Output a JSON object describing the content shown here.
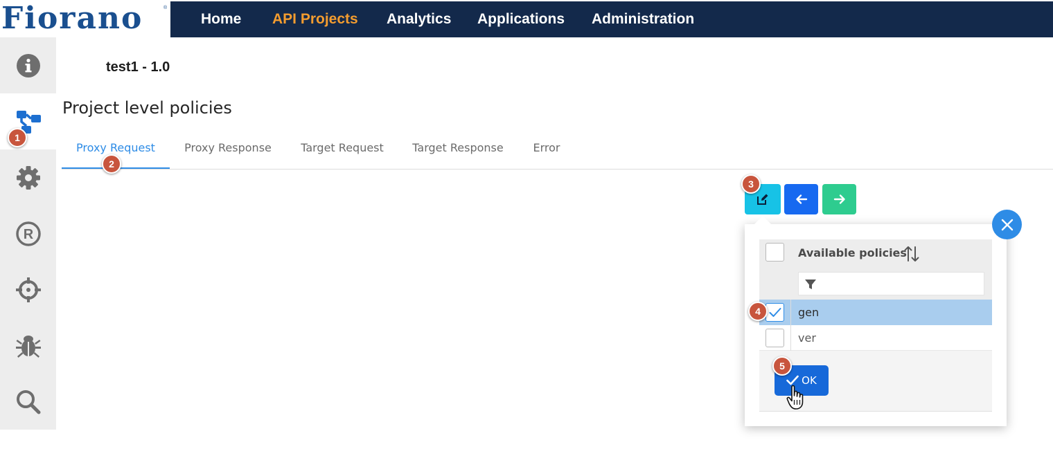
{
  "logo": {
    "text": "Fiorano",
    "reg": "®"
  },
  "nav": {
    "items": [
      {
        "label": "Home",
        "active": false
      },
      {
        "label": "API Projects",
        "active": true
      },
      {
        "label": "Analytics",
        "active": false
      },
      {
        "label": "Applications",
        "active": false
      },
      {
        "label": "Administration",
        "active": false
      }
    ]
  },
  "sidebar": {
    "items": [
      {
        "icon": "info-icon",
        "active": false
      },
      {
        "icon": "flow-icon",
        "active": true
      },
      {
        "icon": "gear-icon",
        "active": false
      },
      {
        "icon": "registered-icon",
        "active": false
      },
      {
        "icon": "crosshair-icon",
        "active": false
      },
      {
        "icon": "bug-icon",
        "active": false
      },
      {
        "icon": "search-icon",
        "active": false
      }
    ]
  },
  "project": {
    "title": "test1 - 1.0"
  },
  "section": {
    "title": "Project level policies"
  },
  "tabs": [
    {
      "label": "Proxy Request",
      "active": true
    },
    {
      "label": "Proxy Response",
      "active": false
    },
    {
      "label": "Target Request",
      "active": false
    },
    {
      "label": "Target Response",
      "active": false
    },
    {
      "label": "Error",
      "active": false
    }
  ],
  "actions": {
    "edit_icon": "edit-icon",
    "left_icon": "arrow-left-icon",
    "right_icon": "arrow-right-icon"
  },
  "policy_list": {
    "header": "Available policies",
    "filter_placeholder": "",
    "rows": [
      {
        "label": "gen",
        "checked": true
      },
      {
        "label": "ver",
        "checked": false
      }
    ],
    "ok_label": "OK"
  },
  "badges": [
    "1",
    "2",
    "3",
    "4",
    "5"
  ],
  "colors": {
    "navbar": "#13294b",
    "nav_active": "#f39c2f",
    "accent": "#2e8ce6",
    "badge": "#c8553d",
    "edit_button": "#17c2e6",
    "left_button": "#1769f0",
    "right_button": "#2ecc8f",
    "selected_row": "#a9cdee"
  }
}
